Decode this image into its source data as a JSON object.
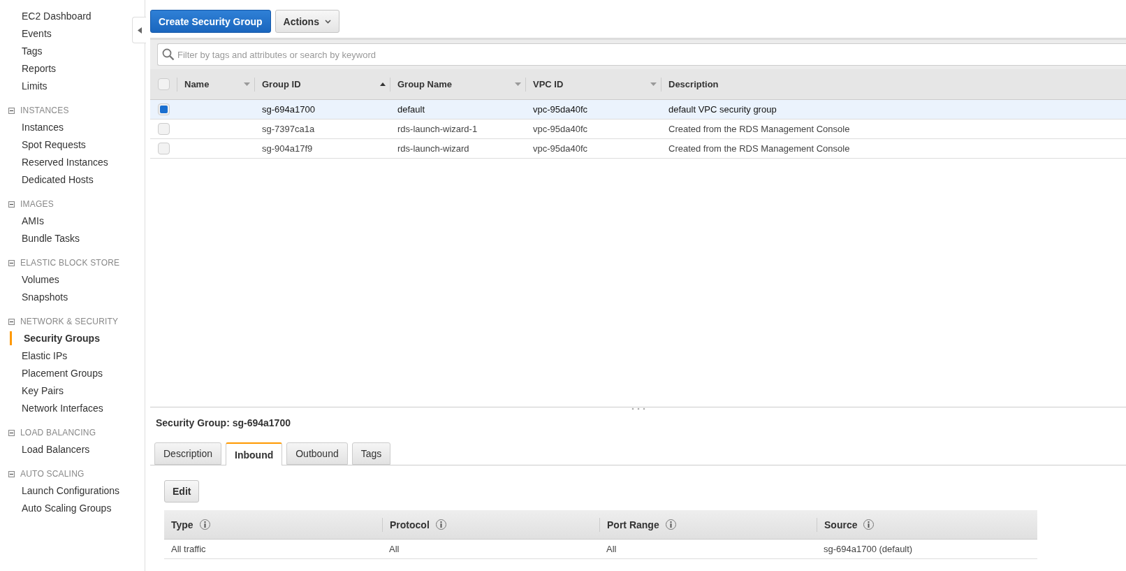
{
  "sidebar": {
    "sections": [
      {
        "items": [
          {
            "label": "EC2 Dashboard",
            "selected": false
          },
          {
            "label": "Events",
            "selected": false
          },
          {
            "label": "Tags",
            "selected": false
          },
          {
            "label": "Reports",
            "selected": false
          },
          {
            "label": "Limits",
            "selected": false
          }
        ]
      },
      {
        "heading": "INSTANCES",
        "expanded": true,
        "items": [
          {
            "label": "Instances",
            "selected": false
          },
          {
            "label": "Spot Requests",
            "selected": false
          },
          {
            "label": "Reserved Instances",
            "selected": false
          },
          {
            "label": "Dedicated Hosts",
            "selected": false
          }
        ]
      },
      {
        "heading": "IMAGES",
        "expanded": true,
        "items": [
          {
            "label": "AMIs",
            "selected": false
          },
          {
            "label": "Bundle Tasks",
            "selected": false
          }
        ]
      },
      {
        "heading": "ELASTIC BLOCK STORE",
        "expanded": true,
        "items": [
          {
            "label": "Volumes",
            "selected": false
          },
          {
            "label": "Snapshots",
            "selected": false
          }
        ]
      },
      {
        "heading": "NETWORK & SECURITY",
        "expanded": true,
        "items": [
          {
            "label": "Security Groups",
            "selected": true
          },
          {
            "label": "Elastic IPs",
            "selected": false
          },
          {
            "label": "Placement Groups",
            "selected": false
          },
          {
            "label": "Key Pairs",
            "selected": false
          },
          {
            "label": "Network Interfaces",
            "selected": false
          }
        ]
      },
      {
        "heading": "LOAD BALANCING",
        "expanded": true,
        "items": [
          {
            "label": "Load Balancers",
            "selected": false
          }
        ]
      },
      {
        "heading": "AUTO SCALING",
        "expanded": true,
        "items": [
          {
            "label": "Launch Configurations",
            "selected": false
          },
          {
            "label": "Auto Scaling Groups",
            "selected": false
          }
        ]
      }
    ]
  },
  "toolbar": {
    "primary_button": "Create Security Group",
    "actions_button": "Actions"
  },
  "search": {
    "placeholder": "Filter by tags and attributes or search by keyword"
  },
  "table": {
    "select_all": {
      "checked": false
    },
    "columns": [
      {
        "label": "Name",
        "sortable": true,
        "sorted": false
      },
      {
        "label": "Group ID",
        "sortable": true,
        "sorted": true
      },
      {
        "label": "Group Name",
        "sortable": true,
        "sorted": false
      },
      {
        "label": "VPC ID",
        "sortable": true,
        "sorted": false
      },
      {
        "label": "Description",
        "sortable": false
      }
    ],
    "rows": [
      {
        "selected": true,
        "cells": [
          "",
          "sg-694a1700",
          "default",
          "vpc-95da40fc",
          "default VPC security group"
        ]
      },
      {
        "selected": false,
        "cells": [
          "",
          "sg-7397ca1a",
          "rds-launch-wizard-1",
          "vpc-95da40fc",
          "Created from the RDS Management Console"
        ]
      },
      {
        "selected": false,
        "cells": [
          "",
          "sg-904a17f9",
          "rds-launch-wizard",
          "vpc-95da40fc",
          "Created from the RDS Management Console"
        ]
      }
    ]
  },
  "details": {
    "title": "Security Group: sg-694a1700",
    "tabs": [
      {
        "label": "Description",
        "selected": false
      },
      {
        "label": "Inbound",
        "selected": true
      },
      {
        "label": "Outbound",
        "selected": false
      },
      {
        "label": "Tags",
        "selected": false
      }
    ],
    "edit_button": "Edit",
    "rules": {
      "columns": [
        "Type",
        "Protocol",
        "Port Range",
        "Source"
      ],
      "rows": [
        [
          "All traffic",
          "All",
          "All",
          "sg-694a1700 (default)"
        ]
      ]
    }
  }
}
